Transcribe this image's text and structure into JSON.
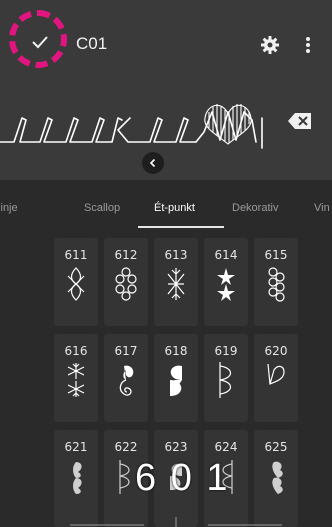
{
  "app": {
    "title": "C01"
  },
  "toolbar": {
    "confirm_icon": "check-icon",
    "settings_icon": "gear-icon",
    "more_icon": "more-vert-icon"
  },
  "preview": {
    "backspace_icon": "backspace-icon",
    "collapse_icon": "chevron-left-icon"
  },
  "tabs": [
    {
      "label": "Ét-linje",
      "active": false
    },
    {
      "label": "Scallop",
      "active": false
    },
    {
      "label": "Ét-punkt",
      "active": true
    },
    {
      "label": "Dekorativ",
      "active": false
    },
    {
      "label": "Vin",
      "active": false
    }
  ],
  "stitches": [
    {
      "number": "611"
    },
    {
      "number": "612"
    },
    {
      "number": "613"
    },
    {
      "number": "614"
    },
    {
      "number": "615"
    },
    {
      "number": "616"
    },
    {
      "number": "617"
    },
    {
      "number": "618"
    },
    {
      "number": "619"
    },
    {
      "number": "620"
    },
    {
      "number": "621"
    },
    {
      "number": "622"
    },
    {
      "number": "623"
    },
    {
      "number": "624"
    },
    {
      "number": "625"
    }
  ],
  "overlay": {
    "value": "6 0 1"
  },
  "colors": {
    "highlight": "#e0157f",
    "topbar": "#3a3a3a",
    "background": "#2a2a2a"
  }
}
